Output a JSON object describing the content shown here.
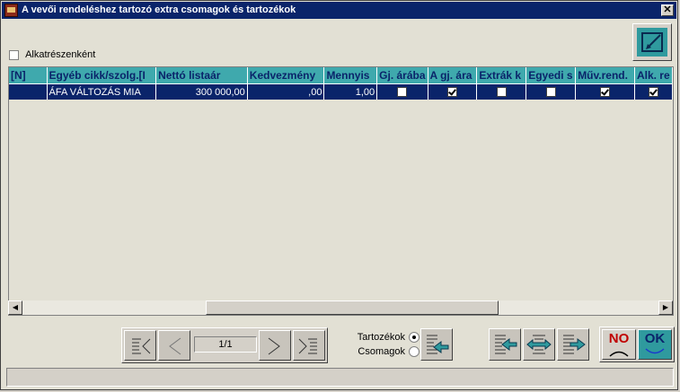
{
  "window": {
    "title": "A vevői rendeléshez tartozó extra csomagok és tartozékok",
    "close_icon": "close-icon"
  },
  "options": {
    "by_part_label": "Alkatrészenként",
    "by_part_checked": false
  },
  "grid": {
    "columns": [
      "[N]",
      "Egyéb cikk/szolg.[I",
      "Nettó listaár",
      "Kedvezmény",
      "Mennyis",
      "Gj. árába",
      "A gj. ára",
      "Extrák k",
      "Egyedi s",
      "Műv.rend.",
      "Alk. re"
    ],
    "rows": [
      {
        "n": "",
        "item": "ÁFA VÁLTOZÁS MIA",
        "net_price": "300 000,00",
        "discount": ",00",
        "quantity": "1,00",
        "gj_arab": false,
        "a_gj_ara": true,
        "extrak": false,
        "egyedi": false,
        "muv_rend": true,
        "alk_re": true
      }
    ]
  },
  "pager": {
    "page": "1/1"
  },
  "scope": {
    "accessories_label": "Tartozékok",
    "packages_label": "Csomagok",
    "selected": "accessories"
  },
  "actions": {
    "no_label": "NO",
    "ok_label": "OK"
  },
  "colors": {
    "title_bar": "#0a246a",
    "header_bg": "#3fa9ad",
    "selected_row": "#0a246a",
    "grid_bg": "#e2e0d4"
  }
}
